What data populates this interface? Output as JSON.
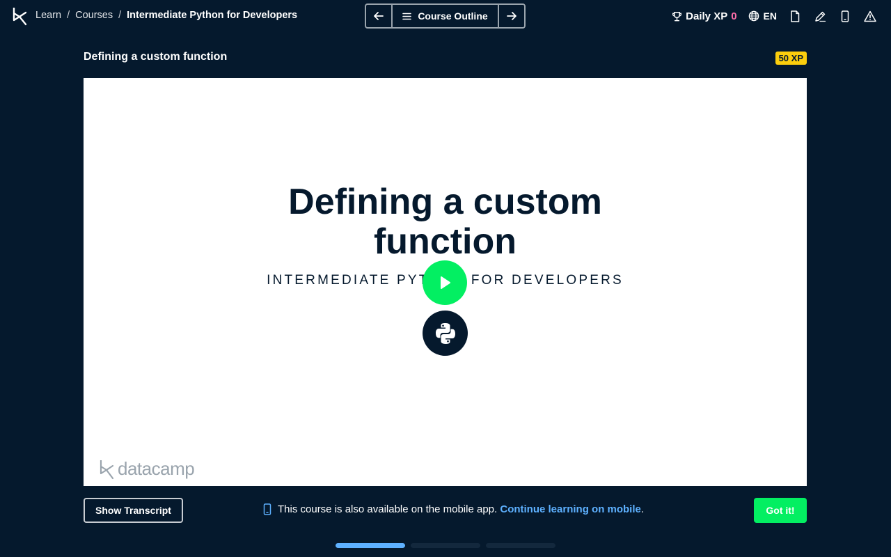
{
  "breadcrumb": {
    "learn": "Learn",
    "separator": "/",
    "courses": "Courses",
    "current": "Intermediate Python for Developers"
  },
  "nav": {
    "prev_icon": "arrow-left-icon",
    "outline_label": "Course Outline",
    "next_icon": "arrow-right-icon"
  },
  "header_tools": {
    "daily_xp_label": "Daily XP",
    "daily_xp_value": "0",
    "language": "EN",
    "icons": [
      "trophy-icon",
      "globe-icon",
      "document-icon",
      "pencil-icon",
      "mobile-icon",
      "warning-icon"
    ]
  },
  "lesson": {
    "title": "Defining a custom function",
    "xp_badge": "50 XP"
  },
  "video": {
    "slide_title_line1": "Defining a custom",
    "slide_title_line2": "function",
    "slide_subtitle": "INTERMEDIATE PYTHON FOR DEVELOPERS",
    "watermark": "datacamp"
  },
  "footer": {
    "transcript_button": "Show Transcript",
    "mobile_message": "This course is also available on the mobile app.",
    "mobile_link": "Continue learning on mobile",
    "mobile_period": ".",
    "got_it_button": "Got it!"
  },
  "progress": {
    "segments": 3,
    "active_index": 0
  },
  "colors": {
    "background": "#05192d",
    "accent_green": "#03ef62",
    "xp_yellow": "#fcce0d",
    "link_blue": "#5eb1ff",
    "xp_pink": "#ff6ea9"
  }
}
